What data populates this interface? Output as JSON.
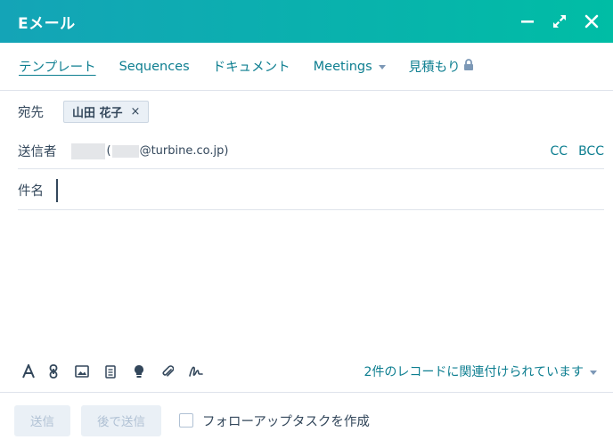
{
  "header": {
    "title": "Eメール"
  },
  "tabs": [
    {
      "label": "テンプレート"
    },
    {
      "label": "Sequences"
    },
    {
      "label": "ドキュメント"
    },
    {
      "label": "Meetings"
    },
    {
      "label": "見積もり"
    }
  ],
  "to": {
    "label": "宛先",
    "recipient": "山田 花子",
    "remove": "×"
  },
  "from": {
    "label": "送信者",
    "email_prefix": "(",
    "email_suffix": "@turbine.co.jp)",
    "cc": "CC",
    "bcc": "BCC"
  },
  "subject": {
    "label": "件名",
    "value": ""
  },
  "toolbar": {
    "icons": [
      "text-format-icon",
      "link-icon",
      "image-icon",
      "document-icon",
      "lightbulb-icon",
      "attachment-icon",
      "signature-icon"
    ],
    "association": "2件のレコードに関連付けられています"
  },
  "footer": {
    "send": "送信",
    "send_later": "後で送信",
    "followup_task": "フォローアップタスクを作成"
  },
  "colors": {
    "header_start": "#14a4b7",
    "header_end": "#00bda5",
    "link": "#0d7e90",
    "text": "#33475b"
  }
}
